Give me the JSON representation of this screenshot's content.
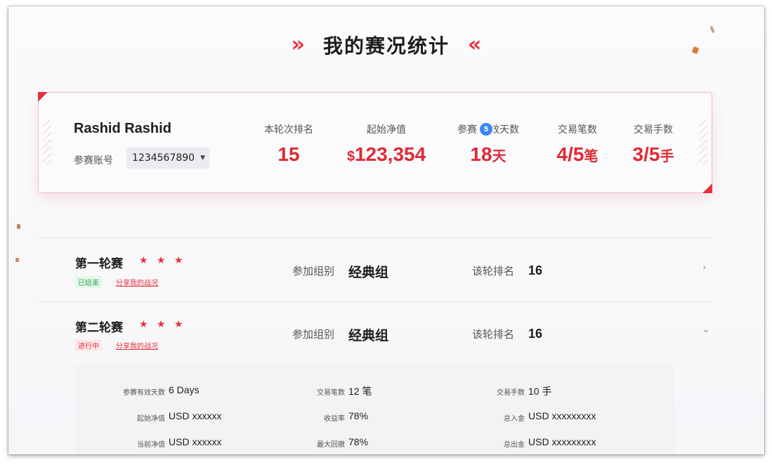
{
  "title": "我的赛况统计",
  "colors": {
    "accent": "#e5313b",
    "tag_ended": "#2fa84f",
    "badge": "#3a87f2"
  },
  "summary": {
    "user_name": "Rashid Rashid",
    "account_label": "参赛账号",
    "account_value": "1234567890",
    "stats": {
      "rank": {
        "label": "本轮次排名",
        "value": "15"
      },
      "start_equity": {
        "label": "起始净值",
        "prefix": "$",
        "value": "123,354"
      },
      "valid_days": {
        "label_a": "参赛",
        "label_b": "效天数",
        "value": "18",
        "unit": "天",
        "badge": "5"
      },
      "trades": {
        "label": "交易笔数",
        "value": "4/5",
        "unit": "笔"
      },
      "lots": {
        "label": "交易手数",
        "value": "3/5",
        "unit": "手"
      }
    }
  },
  "rounds": [
    {
      "name": "第一轮赛",
      "stars": "★ ★ ★",
      "status": "已结束",
      "share": "分享我的战况",
      "group_label": "参加组别",
      "group_value": "经典组",
      "rank_label": "该轮排名",
      "rank_value": "16",
      "arrow": "›"
    },
    {
      "name": "第二轮赛",
      "stars": "★ ★ ★",
      "status": "进行中",
      "share": "分享我的战况",
      "group_label": "参加组别",
      "group_value": "经典组",
      "rank_label": "该轮排名",
      "rank_value": "16",
      "arrow": "⌄"
    }
  ],
  "details": {
    "r1": [
      {
        "label": "参赛有效天数",
        "value": "6 Days"
      },
      {
        "label": "交易笔数",
        "value": "12 笔"
      },
      {
        "label": "交易手数",
        "value": "10 手"
      }
    ],
    "r2": [
      {
        "label": "起始净值",
        "value": "USD xxxxxx"
      },
      {
        "label": "收益率",
        "value": "78%"
      },
      {
        "label": "总入金",
        "value": "USD xxxxxxxxx"
      }
    ],
    "r3": [
      {
        "label": "当前净值",
        "value": "USD xxxxxx"
      },
      {
        "label": "最大回撤",
        "value": "78%"
      },
      {
        "label": "总出金",
        "value": "USD xxxxxxxxx"
      }
    ]
  }
}
